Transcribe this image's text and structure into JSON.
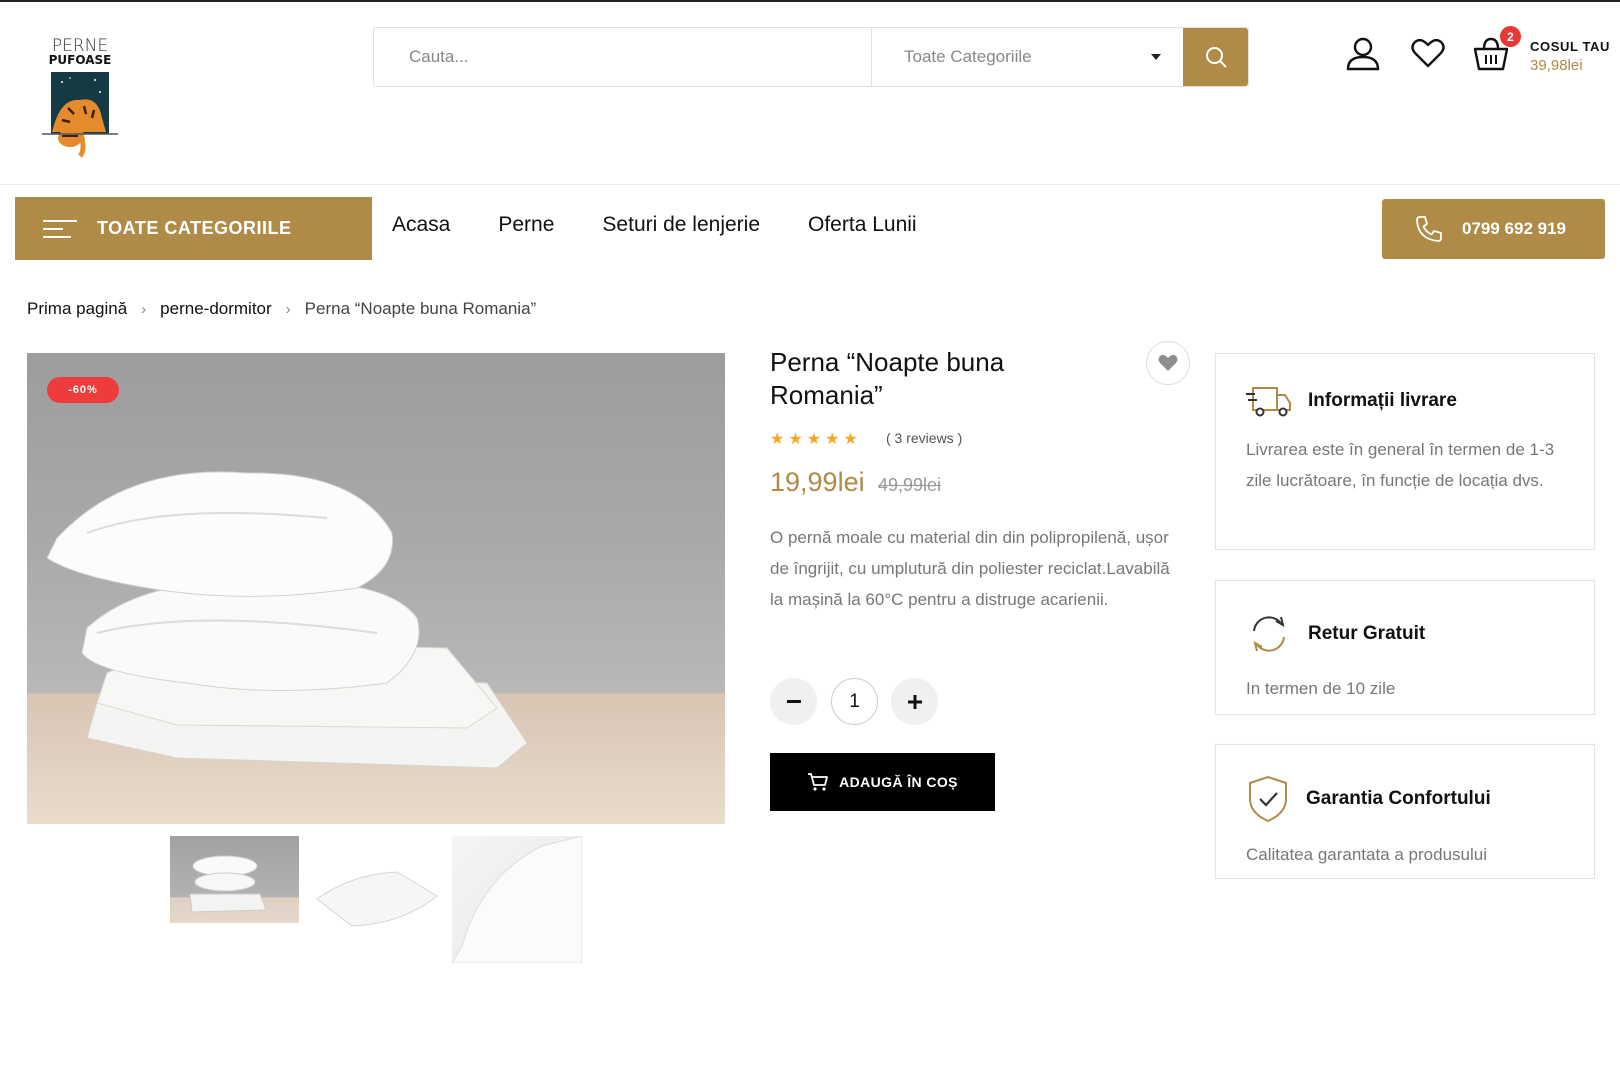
{
  "brand": {
    "line1": "PERNE",
    "line2": "PUFOASE"
  },
  "search": {
    "placeholder": "Cauta...",
    "category": "Toate Categoriile"
  },
  "cart": {
    "badge": "2",
    "title": "COSUL TAU",
    "total": "39,98lei"
  },
  "nav": {
    "categories_label": "TOATE CATEGORIILE",
    "items": [
      "Acasa",
      "Perne",
      "Seturi de lenjerie",
      "Oferta Lunii"
    ],
    "phone": "0799 692 919"
  },
  "breadcrumb": [
    "Prima pagină",
    "perne-dormitor",
    "Perna “Noapte buna Romania”"
  ],
  "product": {
    "discount": "-60%",
    "title": "Perna “Noapte buna Romania”",
    "rating": 5,
    "reviews": "( 3 reviews )",
    "price": "19,99lei",
    "old_price": "49,99lei",
    "description": "O pernă moale cu material din din polipropilenă, ușor de îngrijit, cu umplutură din poliester reciclat.Lavabilă la mașină la 60°C pentru a distruge acarienii.",
    "quantity": "1",
    "add_to_cart": "ADAUGĂ ÎN COȘ"
  },
  "info_boxes": [
    {
      "icon": "truck-icon",
      "title": "Informații livrare",
      "text": "Livrarea este în general în termen de 1-3 zile lucrătoare, în funcție de locația dvs."
    },
    {
      "icon": "refresh-icon",
      "title": "Retur Gratuit",
      "text": "In termen de 10 zile"
    },
    {
      "icon": "shield-check-icon",
      "title": "Garantia Confortului",
      "text": "Calitatea garantata a produsului"
    }
  ],
  "colors": {
    "accent": "#b08a47",
    "badge": "#e53935",
    "discount": "#ee3b3b",
    "star": "#f5a623"
  }
}
